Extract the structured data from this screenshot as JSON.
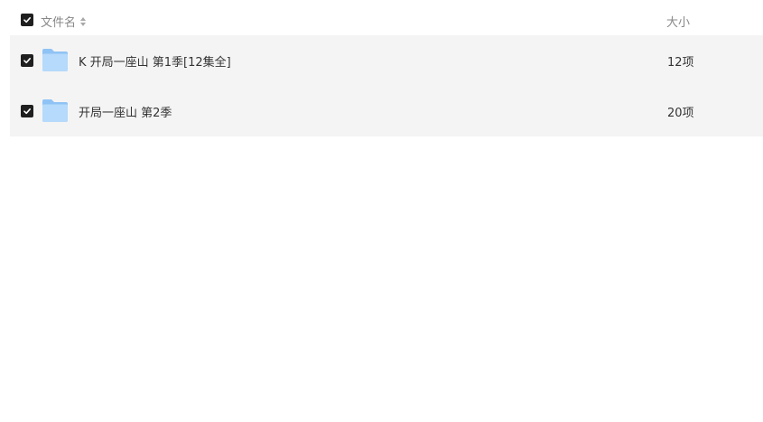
{
  "header": {
    "name_label": "文件名",
    "size_label": "大小",
    "select_all_checked": true
  },
  "files": [
    {
      "name": "K 开局一座山 第1季[12集全]",
      "size": "12项",
      "type": "folder",
      "checked": true
    },
    {
      "name": "开局一座山 第2季",
      "size": "20项",
      "type": "folder",
      "checked": true
    }
  ],
  "colors": {
    "row_background": "#f4f4f4",
    "checkbox": "#1f1f1f",
    "folder_back": "#8fc3f5",
    "folder_front": "#b5dafb",
    "header_text": "#888888",
    "row_text": "#333333"
  },
  "icons": {
    "checkbox": "checkmark-icon",
    "sort": "sort-arrows-icon",
    "folder": "folder-icon"
  }
}
